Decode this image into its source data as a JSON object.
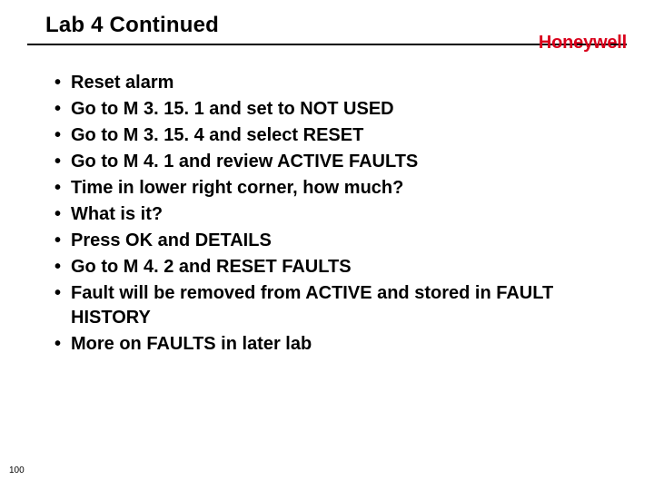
{
  "header": {
    "title": "Lab 4 Continued",
    "brand": "Honeywell"
  },
  "bullets": [
    "Reset alarm",
    "Go to M 3. 15. 1 and set to NOT USED",
    "Go to M 3. 15. 4 and select RESET",
    "Go to M 4. 1 and review ACTIVE FAULTS",
    "Time in lower right corner, how much?",
    "What is it?",
    "Press OK and DETAILS",
    "Go to M 4. 2 and RESET FAULTS",
    "Fault will be removed from ACTIVE and stored in FAULT HISTORY",
    "More on FAULTS in later lab"
  ],
  "page_number": "100"
}
